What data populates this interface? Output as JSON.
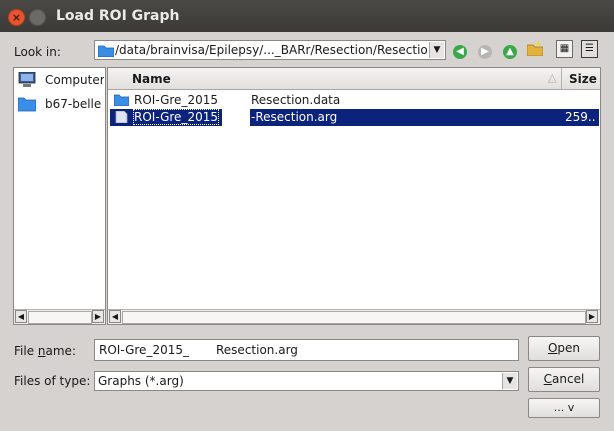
{
  "window": {
    "title": "Load ROI Graph",
    "close_glyph": "×"
  },
  "look_in": {
    "label": "Look in:",
    "path": "/data/brainvisa/Epilepsy/..._BARr/Resection/Resection"
  },
  "toolbar": {
    "back_icon": "arrow-left-icon",
    "forward_icon": "arrow-right-icon",
    "up_icon": "arrow-up-icon",
    "new_folder_icon": "new-folder-icon",
    "list_view_icon": "list-view-icon",
    "detail_view_icon": "detail-view-icon"
  },
  "sidebar": {
    "items": [
      {
        "label": "Computer",
        "icon": "computer-icon"
      },
      {
        "label": "b67-belle",
        "icon": "folder-icon"
      }
    ]
  },
  "file_list": {
    "columns": {
      "name": "Name",
      "size": "Size"
    },
    "rows": [
      {
        "name_a": "ROI-Gre_2015",
        "name_b": "Resection.data",
        "size": "",
        "icon": "folder-icon",
        "selected": false
      },
      {
        "name_a": "ROI-Gre_2015",
        "name_b": "-Resection.arg",
        "size": "259..",
        "icon": "file-icon",
        "selected": true
      }
    ]
  },
  "file_name": {
    "label_prefix": "File ",
    "label_mnemonic": "n",
    "label_suffix": "ame:",
    "value_a": "ROI-Gre_2015_",
    "value_b": "Resection.arg"
  },
  "file_type": {
    "label": "Files of type:",
    "value": "Graphs (*.arg)"
  },
  "buttons": {
    "open_mnemonic": "O",
    "open_rest": "pen",
    "cancel_mnemonic": "C",
    "cancel_rest": "ancel",
    "more": "... v"
  },
  "colors": {
    "selection": "#0b237a",
    "titlebar": "#3b3a37",
    "close": "#e8552c"
  }
}
